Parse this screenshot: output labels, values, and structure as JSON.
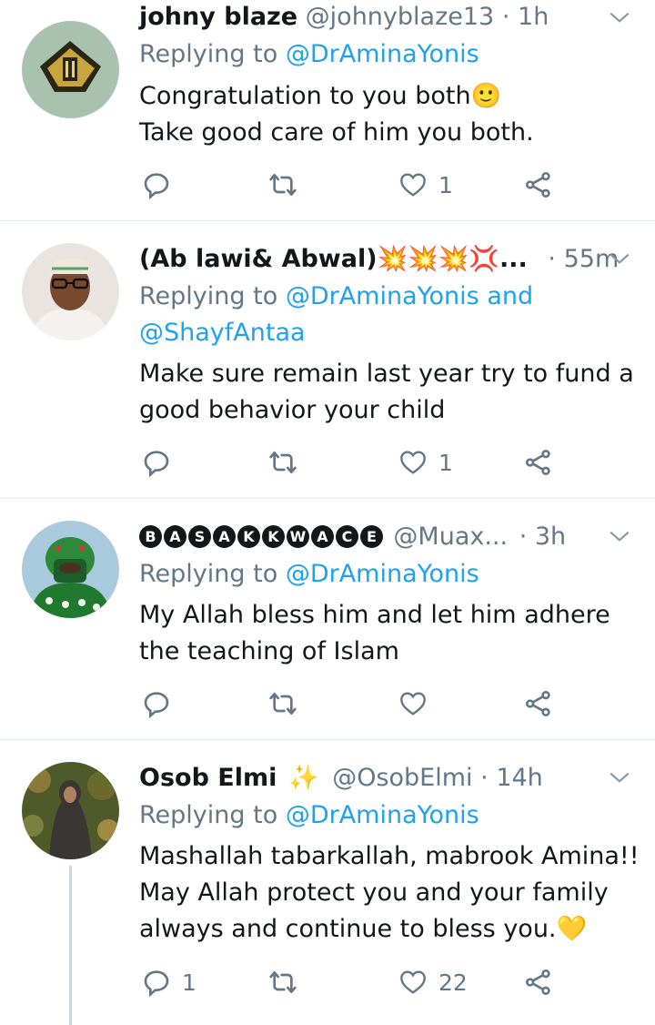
{
  "tweets": [
    {
      "name": "johny blaze",
      "handle": "@johnyblaze13",
      "time": "1h",
      "replying_prefix": "Replying to ",
      "mentions": "@DrAminaYonis",
      "text_lines": [
        "Congratulation to you both🙂",
        "Take good care of him you both."
      ],
      "reply_count": "",
      "retweet_count": "",
      "like_count": "1"
    },
    {
      "name": "(Ab lawi& Abwal)💥💥💥💢...",
      "handle": "",
      "time": "55m",
      "replying_prefix": "Replying to ",
      "mentions": "@DrAminaYonis and",
      "mentions_line2": "@ShayfAntaa",
      "text_lines": [
        "Make sure remain last year try to fund a",
        "good behavior your child"
      ],
      "reply_count": "",
      "retweet_count": "",
      "like_count": "1"
    },
    {
      "name_badges": [
        "B",
        "A",
        "S",
        "A",
        "K",
        "K",
        "W",
        "A",
        "C",
        "E"
      ],
      "handle": "@Muax...",
      "time": "3h",
      "replying_prefix": "Replying to ",
      "mentions": "@DrAminaYonis",
      "text_lines": [
        "My Allah bless him and let him adhere",
        "the teaching of Islam"
      ],
      "reply_count": "",
      "retweet_count": "",
      "like_count": ""
    },
    {
      "name": "Osob Elmi",
      "name_emoji": "✨",
      "handle": "@OsobElmi",
      "time": "14h",
      "replying_prefix": "Replying to ",
      "mentions": "@DrAminaYonis",
      "text_lines": [
        "Mashallah tabarkallah, mabrook Amina!!",
        "May Allah protect you and your family",
        "always and continue to bless you.💛"
      ],
      "reply_count": "1",
      "retweet_count": "",
      "like_count": "22"
    }
  ],
  "separator": "·",
  "colors": {
    "accent": "#1da1f2",
    "muted": "#657786",
    "divider": "#e1e8ed"
  },
  "icons": [
    "chevron-down-icon",
    "reply-icon",
    "retweet-icon",
    "like-icon",
    "share-icon"
  ]
}
